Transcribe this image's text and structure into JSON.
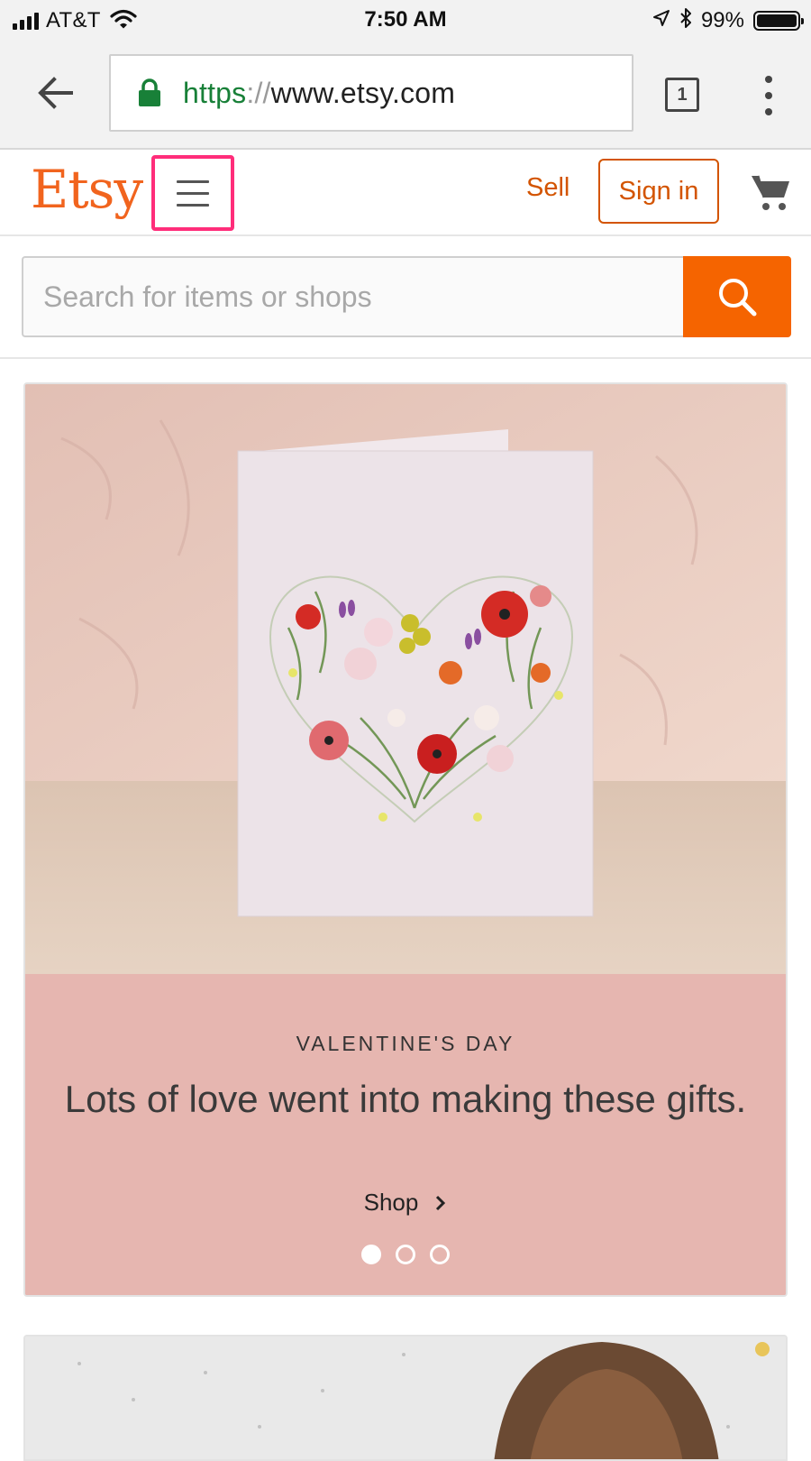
{
  "status_bar": {
    "carrier": "AT&T",
    "time": "7:50 AM",
    "battery_percent": "99%",
    "icons": [
      "signal-bars-icon",
      "wifi-icon",
      "location-arrow-icon",
      "bluetooth-icon",
      "battery-icon"
    ]
  },
  "browser": {
    "url_scheme": "https",
    "url_separator": "://",
    "url_host": "www.etsy.com",
    "tab_count": "1",
    "icons": [
      "back-arrow-icon",
      "lock-icon",
      "tabs-icon",
      "more-vert-icon"
    ],
    "secure_color": "#188038"
  },
  "header": {
    "logo_text": "Etsy",
    "sell_label": "Sell",
    "signin_label": "Sign in",
    "icons": [
      "hamburger-menu-icon",
      "cart-icon"
    ],
    "brand_color": "#f1641e",
    "highlight_color": "#ff2d7a"
  },
  "search": {
    "placeholder": "Search for items or shops",
    "value": "",
    "icons": [
      "search-icon"
    ],
    "button_color": "#f56400"
  },
  "hero": {
    "eyebrow": "VALENTINE'S DAY",
    "headline": "Lots of love went into making these gifts.",
    "shop_label": "Shop",
    "carousel_slides": 3,
    "carousel_active_index": 0,
    "caption_background": "#e6b6b0",
    "icons": [
      "chevron-right-icon"
    ]
  }
}
